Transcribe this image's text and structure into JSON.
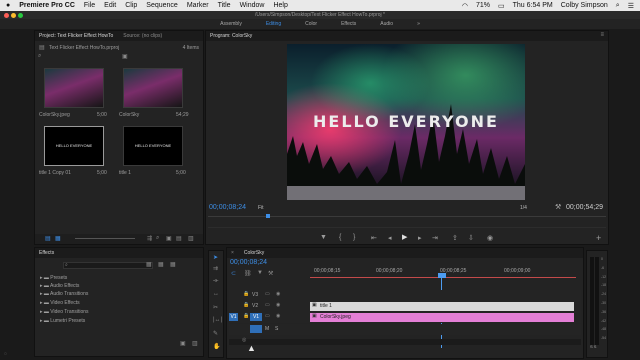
{
  "menubar": {
    "apple": "",
    "items": [
      "Premiere Pro CC",
      "File",
      "Edit",
      "Clip",
      "Sequence",
      "Marker",
      "Title",
      "Window",
      "Help"
    ],
    "battery": "71%",
    "clock": "Thu 6:54 PM",
    "user": "Colby Simpson"
  },
  "titlebar": {
    "path": "/Users/Simpson/Desktop/Text Flicker Effect HowTo.prproj *"
  },
  "workspaces": {
    "items": [
      "Assembly",
      "Editing",
      "Color",
      "Effects",
      "Audio"
    ],
    "active": "Editing",
    "more": "»"
  },
  "project": {
    "tab": "Project: Text Flicker Effect HowTo",
    "source_tab": "Source: (no clips)",
    "file": "Text Flicker Effect HowTo.prproj",
    "count": "4 Items",
    "items": [
      {
        "name": "ColorSky.jpeg",
        "duration": "5;00"
      },
      {
        "name": "ColorSky",
        "duration": "54;29"
      },
      {
        "name": "title 1 Copy 01",
        "duration": "5;00",
        "thumb_text": "HELLO EVERYONE"
      },
      {
        "name": "title 1",
        "duration": "5;00",
        "thumb_text": "HELLO EVERYONE"
      }
    ]
  },
  "program": {
    "tab": "Program: ColorSky",
    "overlay": "HELLO EVERYONE",
    "timecode": "00;00;08;24",
    "fit": "Fit",
    "ratio": "1/4",
    "duration": "00;00;54;29"
  },
  "effects": {
    "tab": "Effects",
    "tree": [
      "Presets",
      "Audio Effects",
      "Audio Transitions",
      "Video Effects",
      "Video Transitions",
      "Lumetri Presets"
    ]
  },
  "timeline": {
    "tab": "ColorSky",
    "timecode": "00;00;08;24",
    "ruler": [
      "00;00;08;15",
      "00;00;08;20",
      "00;00;08;25",
      "00;00;09;00"
    ],
    "tracks": [
      {
        "name": "V3",
        "clip": ""
      },
      {
        "name": "V2",
        "clip": "title 1"
      },
      {
        "name": "V1",
        "clip": "ColorSky.jpeg",
        "src": "V1"
      },
      {
        "name": "A1",
        "clip": ""
      }
    ],
    "meter": [
      "0",
      "-6",
      "-12",
      "-18",
      "-24",
      "-30",
      "-36",
      "-42",
      "-48",
      "-54"
    ],
    "meter_label": "S S"
  },
  "colors": {
    "accent": "#3d8ee6",
    "title_clip": "#d9d9d9",
    "image_clip": "#e47fd6",
    "playhead": "#4d9cf0"
  }
}
